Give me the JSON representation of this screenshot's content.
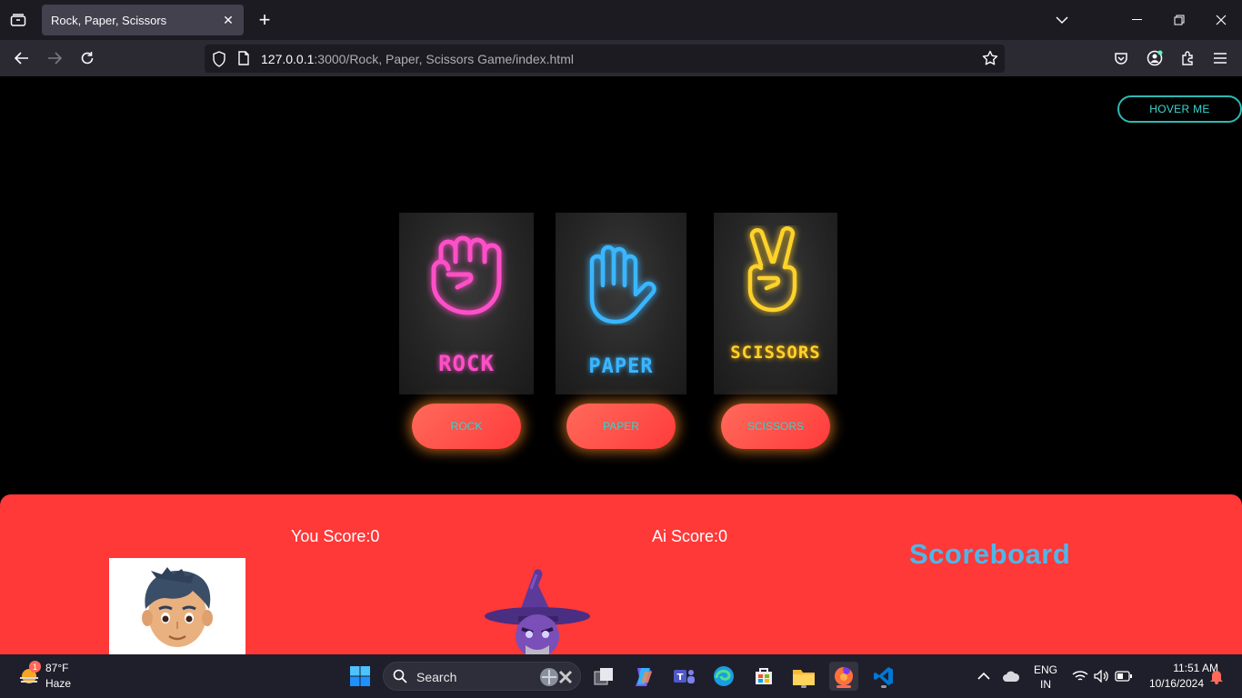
{
  "browser": {
    "tab_title": "Rock, Paper, Scissors",
    "url_host": "127.0.0.1",
    "url_path": ":3000/Rock, Paper, Scissors Game/index.html"
  },
  "page": {
    "hover_button": "HOVER ME",
    "cards": [
      {
        "label": "ROCK",
        "color": "#ff4fc8"
      },
      {
        "label": "PAPER",
        "color": "#3ab6ff"
      },
      {
        "label": "SCISSORS",
        "color": "#ffd22a"
      }
    ],
    "buttons": [
      "ROCK",
      "PAPER",
      "SCISSORS"
    ],
    "scoreboard": {
      "you_score": "You Score:0",
      "ai_score": "Ai Score:0",
      "title": "Scoreboard"
    }
  },
  "taskbar": {
    "weather_temp": "87°F",
    "weather_desc": "Haze",
    "weather_badge": "1",
    "search_label": "Search",
    "lang_line1": "ENG",
    "lang_line2": "IN",
    "time": "11:51 AM",
    "date": "10/16/2024"
  },
  "colors": {
    "scoreboard_bg": "#ff3838",
    "button_text": "#2fd6d0",
    "scoreboard_title": "#4fb6e8"
  }
}
